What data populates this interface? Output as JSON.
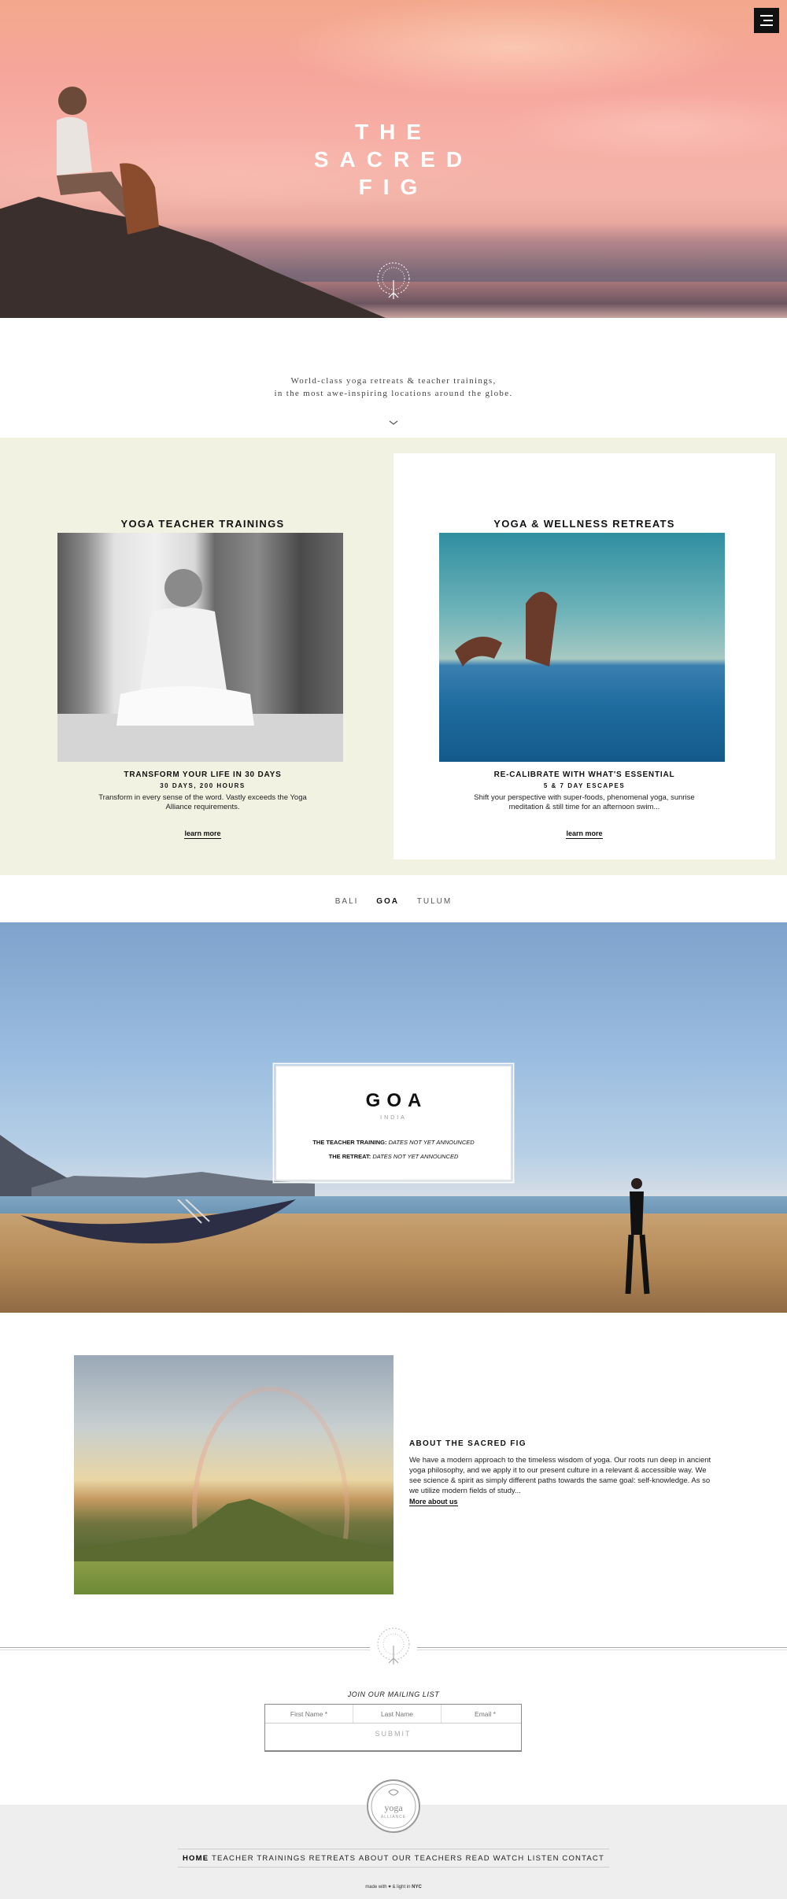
{
  "hero": {
    "title_lines": [
      "THE",
      "SACRED",
      "FIG"
    ]
  },
  "tagline": {
    "line1": "World-class yoga retreats & teacher trainings,",
    "line2": "in the most awe-inspiring locations around the globe."
  },
  "programs": [
    {
      "heading": "YOGA TEACHER TRAININGS",
      "subheading": "TRANSFORM YOUR LIFE IN 30 DAYS",
      "meta": "30 DAYS, 200 HOURS",
      "description": "Transform in every sense of the word. Vastly exceeds the Yoga Alliance requirements.",
      "link": "learn more"
    },
    {
      "heading": "YOGA & WELLNESS RETREATS",
      "subheading": "RE-CALIBRATE WITH WHAT'S ESSENTIAL",
      "meta": "5 & 7 DAY ESCAPES",
      "description": "Shift your perspective with super-foods, phenomenal yoga, sunrise meditation & still time for an afternoon swim...",
      "link": "learn more"
    }
  ],
  "locations": {
    "tabs": [
      "BALI",
      "GOA",
      "TULUM"
    ],
    "active": "GOA"
  },
  "goa": {
    "name": "GOA",
    "country": "INDIA",
    "training_label": "THE TEACHER TRAINING:",
    "training_value": "DATES NOT YET ANNOUNCED",
    "retreat_label": "THE RETREAT:",
    "retreat_value": "DATES NOT YET ANNOUNCED"
  },
  "about": {
    "title": "ABOUT THE SACRED FIG",
    "text": "We have a modern approach to the timeless wisdom of yoga. Our roots run deep in ancient yoga philosophy, and we apply it to our present culture in a relevant & accessible way. We see science & spirit as simply different paths towards the same goal: self-knowledge. As so we utilize modern fields of study...",
    "link": "More about us"
  },
  "mailing": {
    "title": "JOIN OUR MAILING LIST",
    "first_name_placeholder": "First Name *",
    "last_name_placeholder": "Last Name",
    "email_placeholder": "Email *",
    "submit": "SUBMIT"
  },
  "footer": {
    "logo_text": "yoga",
    "logo_sub": "ALLIANCE",
    "nav": [
      "HOME",
      "TEACHER TRAININGS",
      "RETREATS",
      "ABOUT",
      "OUR TEACHERS",
      "READ WATCH LISTEN",
      "CONTACT"
    ],
    "active_nav": "HOME",
    "made_with_prefix": "made with",
    "made_with_middle": "& light in",
    "made_with_city": "NYC"
  },
  "icons": {
    "menu": "hamburger-icon",
    "hero_logo": "tree-logo-icon",
    "scroll": "chevron-down-icon",
    "heart": "heart-icon"
  }
}
